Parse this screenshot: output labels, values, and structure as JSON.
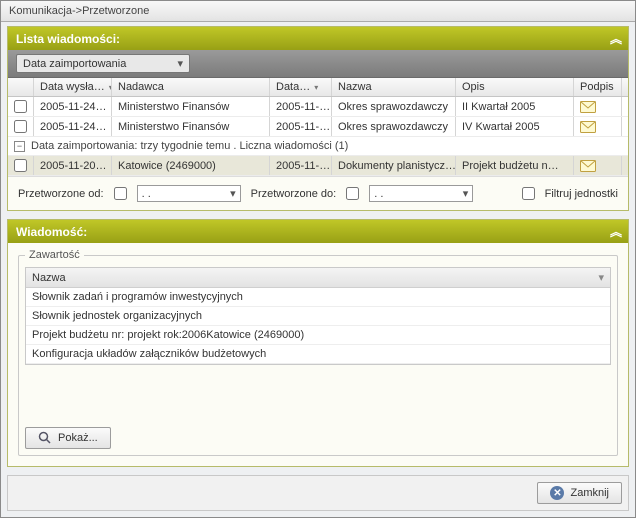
{
  "title": "Komunikacja->Przetworzone",
  "panels": {
    "list": {
      "title": "Lista wiadomości:",
      "combo": "Data zaimportowania",
      "columns": {
        "date_sent": "Data wysła…",
        "sender": "Nadawca",
        "date2": "Data…",
        "name": "Nazwa",
        "desc": "Opis",
        "sig": "Podpis"
      },
      "rows": [
        {
          "date": "2005-11-24…",
          "sender": "Ministerstwo Finansów",
          "date2": "2005-11-…",
          "name": "Okres sprawozdawczy",
          "desc": "II Kwartał 2005"
        },
        {
          "date": "2005-11-24…",
          "sender": "Ministerstwo Finansów",
          "date2": "2005-11-…",
          "name": "Okres sprawozdawczy",
          "desc": "IV Kwartał 2005"
        }
      ],
      "group": "Data zaimportowania:   trzy tygodnie temu . Liczna wiadomości (1)",
      "group_row": {
        "date": "2005-11-20…",
        "sender": "Katowice (2469000)",
        "date2": "2005-11-…",
        "name": "Dokumenty planistycz…",
        "desc": "Projekt budżetu n…"
      },
      "filter": {
        "from_label": "Przetworzone od:",
        "to_label": "Przetworzone do:",
        "date_placeholder": "   .    .    ",
        "filter_units": "Filtruj jednostki"
      }
    },
    "msg": {
      "title": "Wiadomość:",
      "legend": "Zawartość",
      "col": "Nazwa",
      "items": [
        "Słownik zadań i programów inwestycyjnych",
        "Słownik jednostek organizacyjnych",
        "Projekt budżetu nr: projekt rok:2006Katowice (2469000)",
        "Konfiguracja układów załączników budżetowych"
      ],
      "show_btn": "Pokaż..."
    }
  },
  "close_btn": "Zamknij"
}
